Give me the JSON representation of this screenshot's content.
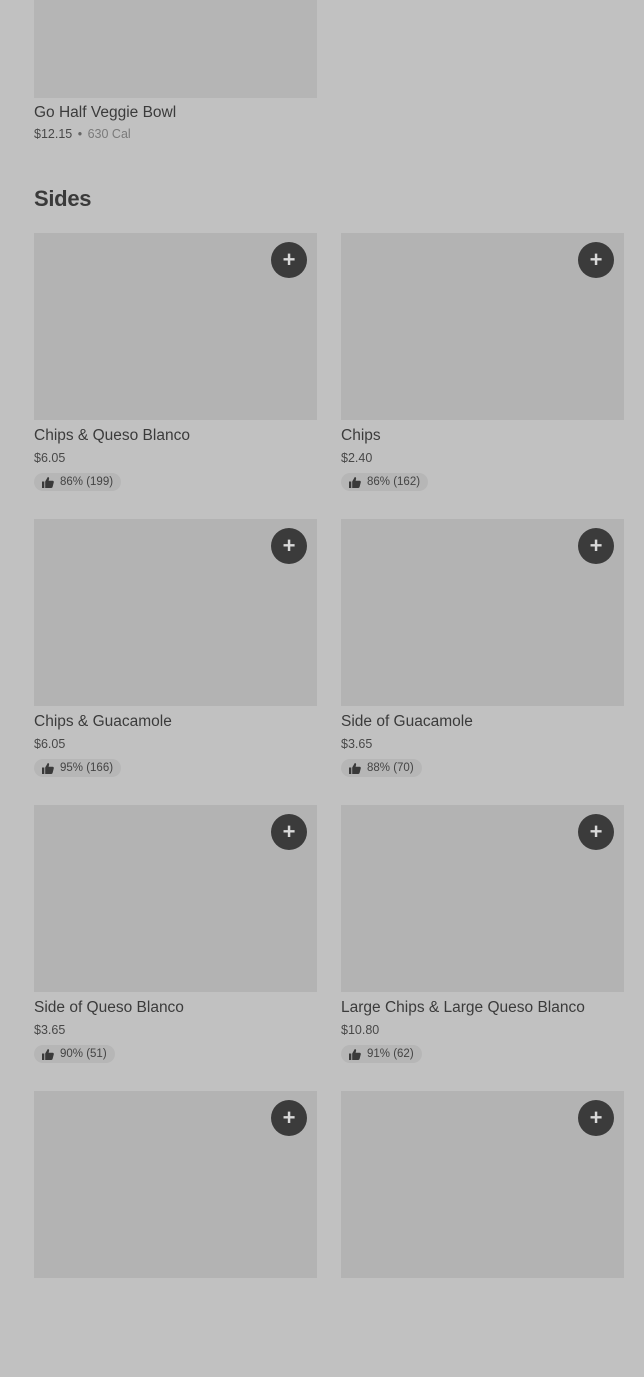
{
  "top_item": {
    "name": "Go Half Veggie Bowl",
    "price": "$12.15",
    "separator": "•",
    "calories": "630 Cal"
  },
  "section": {
    "title": "Sides"
  },
  "items": [
    {
      "name": "Chips & Queso Blanco",
      "price": "$6.05",
      "rating": "86% (199)"
    },
    {
      "name": "Chips",
      "price": "$2.40",
      "rating": "86% (162)"
    },
    {
      "name": "Chips & Guacamole",
      "price": "$6.05",
      "rating": "95% (166)"
    },
    {
      "name": "Side of Guacamole",
      "price": "$3.65",
      "rating": "88% (70)"
    },
    {
      "name": "Side of Queso Blanco",
      "price": "$3.65",
      "rating": "90% (51)"
    },
    {
      "name": "Large Chips & Large Queso Blanco",
      "price": "$10.80",
      "rating": "91% (62)"
    },
    {
      "name": "",
      "price": "",
      "rating": ""
    },
    {
      "name": "",
      "price": "",
      "rating": ""
    }
  ],
  "add_button": {
    "symbol": "+"
  },
  "icons": {
    "add": "plus-icon",
    "rating": "thumbs-up-icon"
  },
  "colors": {
    "background": "#c1c1c1",
    "button": "#3b3b3b",
    "image_placeholder": "#b3b3b3"
  }
}
